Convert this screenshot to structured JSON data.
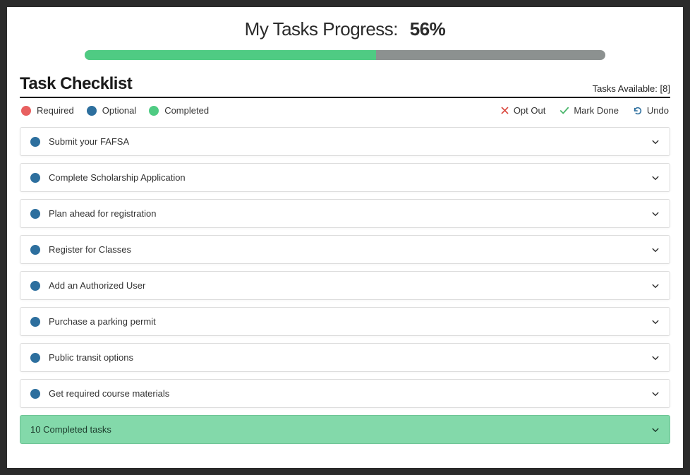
{
  "header": {
    "title": "My Tasks Progress:",
    "percent_text": "56%",
    "percent_value": 56
  },
  "section": {
    "title": "Task Checklist",
    "tasks_available_label": "Tasks Available:",
    "tasks_available_count": "[8]"
  },
  "legend": {
    "required": "Required",
    "optional": "Optional",
    "completed": "Completed"
  },
  "actions": {
    "opt_out": "Opt Out",
    "mark_done": "Mark Done",
    "undo": "Undo"
  },
  "tasks": [
    {
      "label": "Submit your FAFSA",
      "status": "optional"
    },
    {
      "label": "Complete Scholarship Application",
      "status": "optional"
    },
    {
      "label": "Plan ahead for registration",
      "status": "optional"
    },
    {
      "label": "Register for Classes",
      "status": "optional"
    },
    {
      "label": "Add an Authorized User",
      "status": "optional"
    },
    {
      "label": "Purchase a parking permit",
      "status": "optional"
    },
    {
      "label": "Public transit options",
      "status": "optional"
    },
    {
      "label": "Get required course materials",
      "status": "optional"
    }
  ],
  "completed_bar": {
    "label": "10 Completed tasks"
  },
  "colors": {
    "required": "#e86060",
    "optional": "#2d6f9e",
    "completed": "#4fcb83",
    "completed_bar": "#83d9aa"
  }
}
